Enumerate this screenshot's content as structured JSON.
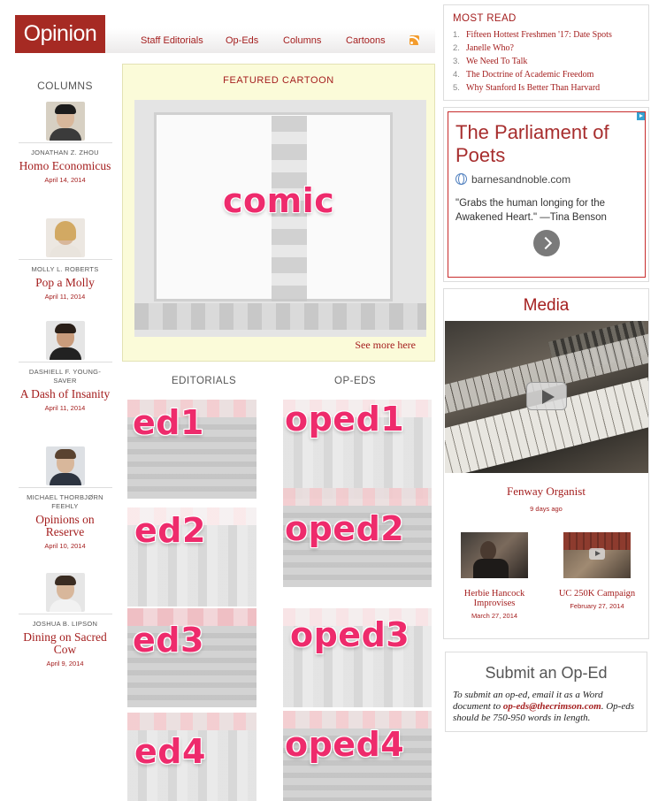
{
  "header": {
    "section_title": "Opinion",
    "nav": [
      "Staff Editorials",
      "Op-Eds",
      "Columns",
      "Cartoons"
    ],
    "rss_icon": "rss-icon"
  },
  "columns": {
    "heading": "COLUMNS",
    "entries": [
      {
        "author": "JONATHAN Z. ZHOU",
        "title": "Homo Economicus",
        "date": "April 14, 2014"
      },
      {
        "author": "MOLLY L. ROBERTS",
        "title": "Pop a Molly",
        "date": "April 11, 2014"
      },
      {
        "author": "DASHIELL F. YOUNG-SAVER",
        "title": "A Dash of Insanity",
        "date": "April 11, 2014"
      },
      {
        "author": "MICHAEL THORBJØRN FEEHLY",
        "title": "Opinions on Reserve",
        "date": "April 10, 2014"
      },
      {
        "author": "JOSHUA B. LIPSON",
        "title": "Dining on Sacred Cow",
        "date": "April 9, 2014"
      }
    ]
  },
  "featured_cartoon": {
    "heading": "FEATURED CARTOON",
    "image_label": "comic",
    "see_more": "See more here"
  },
  "editorials": {
    "heading": "EDITORIALS",
    "labels": [
      "ed1",
      "ed2",
      "ed3",
      "ed4"
    ]
  },
  "opeds": {
    "heading": "OP-EDS",
    "labels": [
      "oped1",
      "oped2",
      "oped3",
      "oped4"
    ]
  },
  "most_read": {
    "heading": "MOST READ",
    "items": [
      {
        "num": "1.",
        "title": "Fifteen Hottest Freshmen '17: Date Spots"
      },
      {
        "num": "2.",
        "title": "Janelle Who?"
      },
      {
        "num": "3.",
        "title": "We Need To Talk"
      },
      {
        "num": "4.",
        "title": "The Doctrine of Academic Freedom"
      },
      {
        "num": "5.",
        "title": "Why Stanford Is Better Than Harvard"
      }
    ]
  },
  "ad": {
    "title": "The Parliament of Poets",
    "domain": "barnesandnoble.com",
    "quote": "\"Grabs the human longing for the Awakened Heart.\" —Tina Benson"
  },
  "media": {
    "heading": "Media",
    "main": {
      "title": "Fenway Organist",
      "date": "9 days ago"
    },
    "items": [
      {
        "title": "Herbie Hancock Improvises",
        "date": "March 27, 2014"
      },
      {
        "title": "UC 250K Campaign",
        "date": "February 27, 2014"
      }
    ]
  },
  "submit": {
    "heading": "Submit an Op-Ed",
    "text_before": "To submit an op-ed, email it as a Word document to ",
    "email": "op-eds@thecrimson.com",
    "text_after": ". Op-eds should be 750-950 words in length."
  },
  "colors": {
    "accent": "#a41e1e",
    "logo_bg": "#a62a23",
    "cartoon_bg": "#fbfbd9",
    "sticker": "#ee2b6c"
  }
}
